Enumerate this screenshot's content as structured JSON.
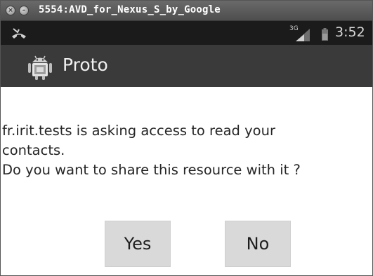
{
  "window": {
    "title": "5554:AVD_for_Nexus_S_by_Google"
  },
  "statusbar": {
    "notification_icon": "missed-call-icon",
    "network_type": "3G",
    "signal_icon": "signal-bars-icon",
    "battery_icon": "battery-icon",
    "time": "3:52"
  },
  "appbar": {
    "icon": "android-robot-icon",
    "title": "Proto"
  },
  "dialog": {
    "message": "fr.irit.tests is asking access to read your\ncontacts.\nDo you want to share this resource with it ?",
    "yes_label": "Yes",
    "no_label": "No"
  },
  "colors": {
    "titlebar": "#5a5a5a",
    "statusbar": "#1b1b1b",
    "appbar": "#3a3a3a",
    "button": "#d9d9d9"
  }
}
